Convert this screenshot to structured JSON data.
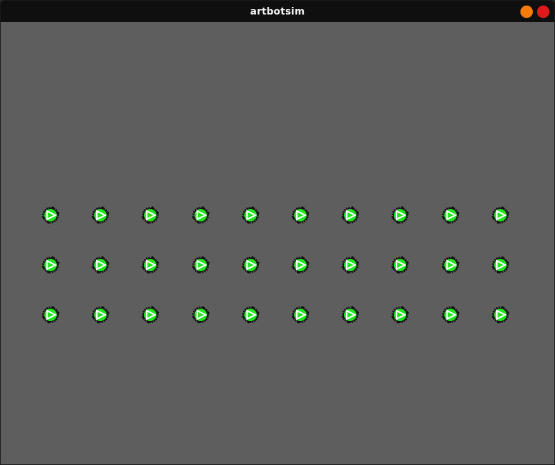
{
  "window": {
    "title": "artbotsim",
    "minimize_color": "#f57c0a",
    "close_color": "#dd1b1b",
    "minimize_icon": "orange-circle",
    "close_icon": "red-circle"
  },
  "canvas": {
    "background": "#5e5e5e",
    "robot_rows": 3,
    "robot_columns": 10,
    "robot_color": "#1fe51f",
    "robot_icon": "green-robot-with-triangle-marker"
  }
}
